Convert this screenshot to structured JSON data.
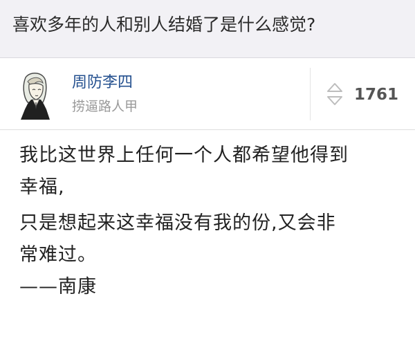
{
  "question": {
    "title": "喜欢多年的人和别人结婚了是什么感觉?"
  },
  "answer": {
    "author": {
      "name": "周防李四",
      "bio": "捞逼路人甲",
      "avatar_icon": "cartoon-avatar-icon"
    },
    "votes": {
      "count": "1761",
      "icon": "vote-arrows-icon"
    },
    "lines": [
      "我比这世界上任何一个人都希望他得到",
      "幸福,",
      "只是想起来这幸福没有我的份,又会非",
      "常难过。",
      "——南康"
    ]
  },
  "colors": {
    "question_bg": "#f2f1f5",
    "author_name": "#24508f",
    "bio": "#9a9a9a",
    "text": "#222222",
    "vote_count": "#555555"
  }
}
